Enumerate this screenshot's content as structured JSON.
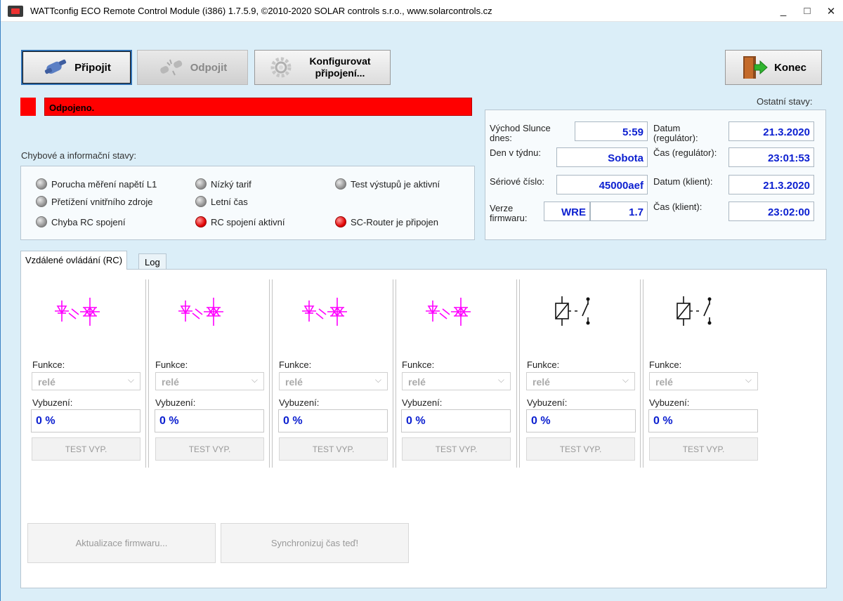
{
  "window": {
    "title": "WATTconfig ECO Remote Control Module (i386) 1.7.5.9, ©2010-2020 SOLAR controls s.r.o., www.solarcontrols.cz",
    "minimize": "_",
    "maximize": "□",
    "close": "✕"
  },
  "toolbar": {
    "connect": "Připojit",
    "disconnect": "Odpojit",
    "configure": "Konfigurovat připojení...",
    "exit": "Konec"
  },
  "status": {
    "text": "Odpojeno.",
    "color": "#ff0000"
  },
  "errors": {
    "title": "Chybové a informační stavy:",
    "items": [
      {
        "label": "Porucha měření napětí L1",
        "on": false
      },
      {
        "label": "Přetížení vnitřního zdroje",
        "on": false
      },
      {
        "label": "Chyba RC spojení",
        "on": false
      },
      {
        "label": "Nízký tarif",
        "on": false
      },
      {
        "label": "Letní čas",
        "on": false
      },
      {
        "label": "RC spojení aktivní",
        "on": true
      },
      {
        "label": "Test výstupů je aktivní",
        "on": false
      },
      {
        "label": "SC-Router je připojen",
        "on": true
      }
    ]
  },
  "other": {
    "title": "Ostatní stavy:",
    "sunrise_label": "Východ Slunce dnes:",
    "sunrise": "5:59",
    "weekday_label": "Den v týdnu:",
    "weekday": "Sobota",
    "serial_label": "Sériové číslo:",
    "serial": "45000aef",
    "fw_label": "Verze firmwaru:",
    "fw_type": "WRE",
    "fw_ver": "1.7",
    "date_reg_label": "Datum (regulátor):",
    "date_reg": "21.3.2020",
    "time_reg_label": "Čas (regulátor):",
    "time_reg": "23:01:53",
    "date_cli_label": "Datum (klient):",
    "date_cli": "21.3.2020",
    "time_cli_label": "Čas (klient):",
    "time_cli": "23:02:00"
  },
  "tabs": [
    "Vzdálené ovládání (RC)",
    "Log"
  ],
  "outputs": [
    {
      "icon": "triac-icon",
      "function_label": "Funkce:",
      "function": "relé",
      "excitation_label": "Vybuzení:",
      "excitation": "0 %",
      "test": "TEST VYP."
    },
    {
      "icon": "triac-icon",
      "function_label": "Funkce:",
      "function": "relé",
      "excitation_label": "Vybuzení:",
      "excitation": "0 %",
      "test": "TEST VYP."
    },
    {
      "icon": "triac-icon",
      "function_label": "Funkce:",
      "function": "relé",
      "excitation_label": "Vybuzení:",
      "excitation": "0 %",
      "test": "TEST VYP."
    },
    {
      "icon": "triac-icon",
      "function_label": "Funkce:",
      "function": "relé",
      "excitation_label": "Vybuzení:",
      "excitation": "0 %",
      "test": "TEST VYP."
    },
    {
      "icon": "relay-icon",
      "function_label": "Funkce:",
      "function": "relé",
      "excitation_label": "Vybuzení:",
      "excitation": "0 %",
      "test": "TEST VYP."
    },
    {
      "icon": "relay-icon",
      "function_label": "Funkce:",
      "function": "relé",
      "excitation_label": "Vybuzení:",
      "excitation": "0 %",
      "test": "TEST VYP."
    }
  ],
  "footer": {
    "firmware_update": "Aktualizace firmwaru...",
    "sync_time": "Synchronizuj čas teď!"
  },
  "colors": {
    "accent": "#0b1fd0",
    "triac": "#ff00ff",
    "background": "#dbeef8"
  }
}
